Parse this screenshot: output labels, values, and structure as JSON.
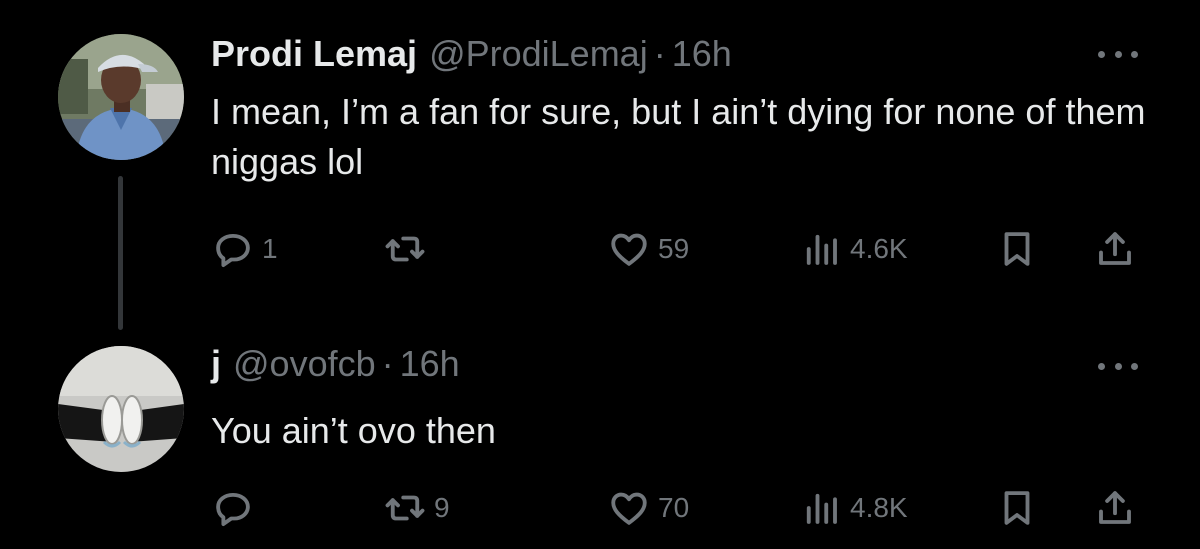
{
  "tweets": [
    {
      "display_name": "Prodi Lemaj",
      "handle": "@ProdiLemaj",
      "separator": "·",
      "time": "16h",
      "text": "I mean, I’m a fan for sure, but I ain’t dying for none of them niggas lol",
      "replies": "1",
      "retweets": "",
      "likes": "59",
      "views": "4.6K"
    },
    {
      "display_name": "j",
      "handle": "@ovofcb",
      "separator": "·",
      "time": "16h",
      "text": "You ain’t ovo then",
      "replies": "",
      "retweets": "9",
      "likes": "70",
      "views": "4.8K"
    }
  ],
  "colors": {
    "background": "#000000",
    "primary_text": "#e7e9ea",
    "secondary_text": "#71767b",
    "thread_line": "#333639"
  },
  "icons": [
    "reply-icon",
    "retweet-icon",
    "like-icon",
    "views-icon",
    "bookmark-icon",
    "share-icon",
    "more-icon"
  ]
}
